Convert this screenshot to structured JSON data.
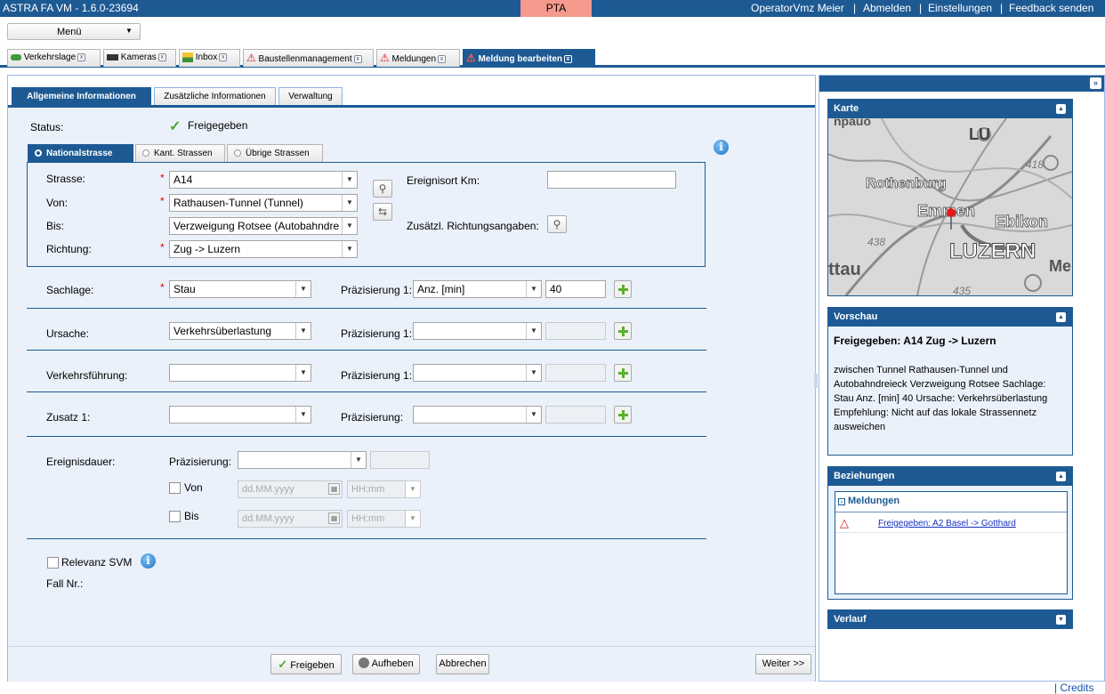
{
  "topbar": {
    "app_title": "ASTRA FA VM - 1.6.0-23694",
    "env_badge": "PTA",
    "user_links": [
      "OperatorVmz Meier",
      "Abmelden",
      "Einstellungen",
      "Feedback senden"
    ],
    "separator": "|",
    "colors": {
      "brand": "#1d5a93",
      "env": "#f59a8d"
    }
  },
  "menu": {
    "label": "Menü"
  },
  "app_tabs": [
    {
      "label": "Verkehrslage",
      "icon": "car-icon"
    },
    {
      "label": "Kameras",
      "icon": "camera-icon"
    },
    {
      "label": "Inbox",
      "icon": "inbox-icon"
    },
    {
      "label": "Baustellenmanagement",
      "icon": "warning-triangle-icon"
    },
    {
      "label": "Meldungen",
      "icon": "warning-triangle-icon"
    },
    {
      "label": "Meldung bearbeiten",
      "icon": "edit-warning-icon",
      "active": true
    }
  ],
  "form_tabs": [
    "Allgemeine Informationen",
    "Zusätzliche Informationen",
    "Verwaltung"
  ],
  "status": {
    "label": "Status:",
    "value": "Freigegeben"
  },
  "road_tabs": [
    "Nationalstrasse",
    "Kant. Strassen",
    "Übrige Strassen"
  ],
  "road": {
    "strasse_label": "Strasse:",
    "strasse_value": "A14",
    "von_label": "Von:",
    "von_value": "Rathausen-Tunnel (Tunnel)",
    "bis_label": "Bis:",
    "bis_value": "Verzweigung Rotsee (Autobahndre",
    "richtung_label": "Richtung:",
    "richtung_value": "Zug -> Luzern",
    "ereignisort_label": "Ereignisort Km:",
    "ereignisort_value": "",
    "zusatz_richtung_label": "Zusätzl. Richtungsangaben:"
  },
  "rows": {
    "sachlage": {
      "label": "Sachlage:",
      "value": "Stau",
      "praez_label": "Präzisierung 1:",
      "praez_value": "Anz. [min]",
      "extra": "40"
    },
    "ursache": {
      "label": "Ursache:",
      "value": "Verkehrsüberlastung",
      "praez_label": "Präzisierung 1:",
      "praez_value": "",
      "extra": ""
    },
    "verkehrsfuehrung": {
      "label": "Verkehrsführung:",
      "value": "",
      "praez_label": "Präzisierung 1:",
      "praez_value": "",
      "extra": ""
    },
    "zusatz1": {
      "label": "Zusatz 1:",
      "value": "",
      "praez_label": "Präzisierung:",
      "praez_value": "",
      "extra": ""
    }
  },
  "ereignisdauer": {
    "label": "Ereignisdauer:",
    "praez_label": "Präzisierung:",
    "von_label": "Von",
    "bis_label": "Bis",
    "date_placeholder": "dd.MM.yyyy",
    "time_placeholder": "HH:mm"
  },
  "relevanz": {
    "label": "Relevanz SVM",
    "fall_label": "Fall Nr.:"
  },
  "buttons": {
    "freigeben": "Freigeben",
    "aufheben": "Aufheben",
    "abbrechen": "Abbrechen",
    "weiter": "Weiter >>"
  },
  "right": {
    "karte_title": "Karte",
    "map_labels": [
      "LU",
      "Rothenburg",
      "Emmen",
      "Ebikon",
      "LUZERN",
      "ttau",
      "Me",
      "418",
      "438",
      "435",
      "npauo"
    ],
    "vorschau_title": "Vorschau",
    "vorschau_heading": "Freigegeben: A14 Zug -> Luzern",
    "vorschau_text": "zwischen Tunnel Rathausen-Tunnel und Autobahndreieck Verzweigung Rotsee Sachlage: Stau Anz. [min] 40 Ursache: Verkehrsüberlastung Empfehlung: Nicht auf das lokale Strassennetz ausweichen",
    "beziehungen_title": "Beziehungen",
    "meldungen_group": "Meldungen",
    "meldung_link": "Freigegeben: A2 Basel -> Gotthard",
    "verlauf_title": "Verlauf"
  },
  "footer": {
    "credits": "| Credits"
  }
}
